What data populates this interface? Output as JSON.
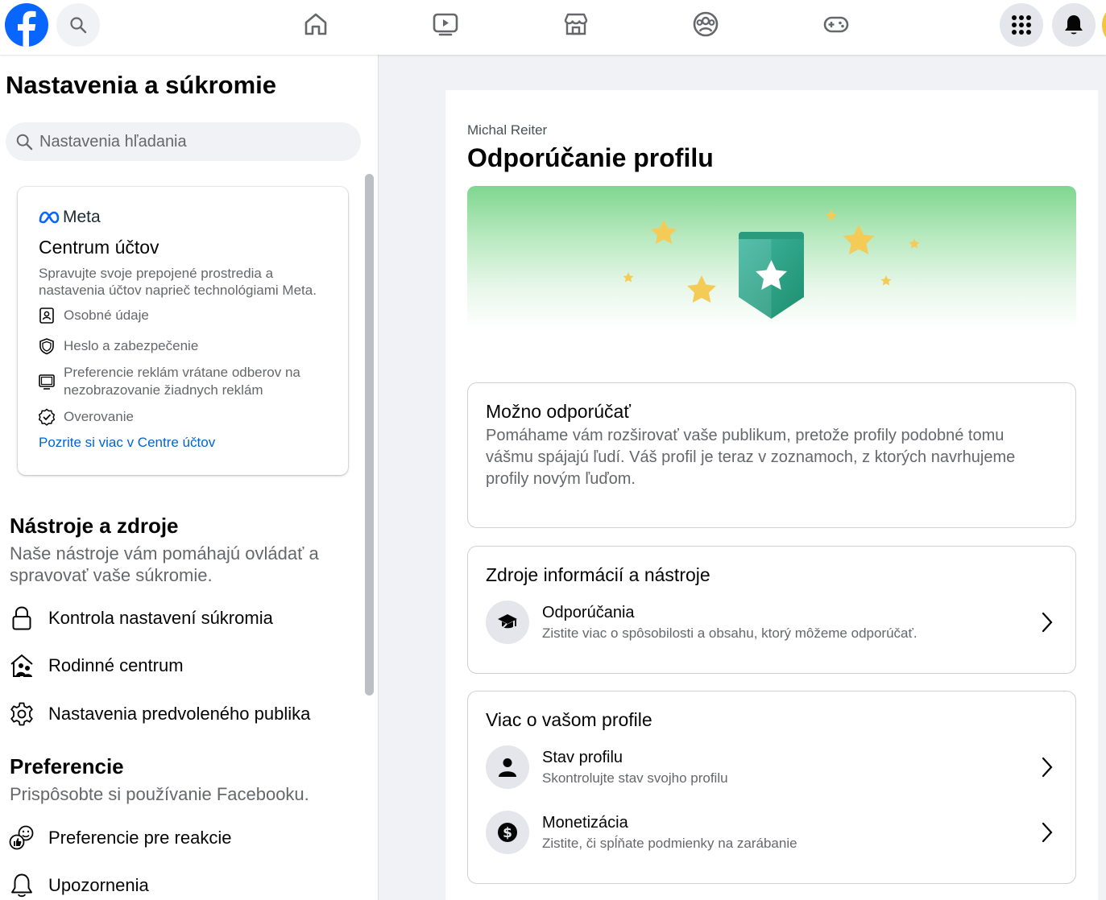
{
  "topbar": {
    "nav": [
      "home-icon",
      "watch-icon",
      "marketplace-icon",
      "groups-icon",
      "gaming-icon"
    ],
    "right": [
      "menu-icon",
      "notifications-icon"
    ]
  },
  "sidebar": {
    "title": "Nastavenia a súkromie",
    "search_placeholder": "Nastavenia hľadania",
    "meta_card": {
      "brand": "Meta",
      "title": "Centrum účtov",
      "description": "Spravujte svoje prepojené prostredia a nastavenia účtov naprieč technológiami Meta.",
      "items": [
        {
          "icon": "id-card-icon",
          "label": "Osobné údaje"
        },
        {
          "icon": "shield-icon",
          "label": "Heslo a zabezpečenie"
        },
        {
          "icon": "monitor-icon",
          "label": "Preferencie reklám vrátane odberov na nezobrazovanie žiadnych reklám"
        },
        {
          "icon": "verified-check-icon",
          "label": "Overovanie"
        }
      ],
      "link": "Pozrite si viac v Centre účtov"
    },
    "tools": {
      "title": "Nástroje a zdroje",
      "description": "Naše nástroje vám pomáhajú ovládať a spravovať vaše súkromie.",
      "items": [
        {
          "icon": "lock-icon",
          "label": "Kontrola nastavení súkromia"
        },
        {
          "icon": "family-home-icon",
          "label": "Rodinné centrum"
        },
        {
          "icon": "gear-icon",
          "label": "Nastavenia predvoleného publika"
        }
      ]
    },
    "preferences": {
      "title": "Preferencie",
      "description": "Prispôsobte si používanie Facebooku.",
      "items": [
        {
          "icon": "reactions-icon",
          "label": "Preferencie pre reakcie"
        },
        {
          "icon": "bell-icon",
          "label": "Upozornenia"
        }
      ]
    }
  },
  "main": {
    "owner": "Michal Reiter",
    "title": "Odporúčanie profilu",
    "status_card": {
      "title": "Možno odporúčať",
      "text": "Pomáhame vám rozširovať vaše publikum, pretože profily podobné tomu vášmu spájajú ľudí. Váš profil je teraz v zoznamoch, z ktorých navrhujeme profily novým ľuďom."
    },
    "resources_card": {
      "title": "Zdroje informácií a nástroje",
      "rows": [
        {
          "icon": "graduation-cap-icon",
          "title": "Odporúčania",
          "subtitle": "Zistite viac o spôsobilosti a obsahu, ktorý môžeme odporúčať."
        }
      ]
    },
    "profile_card": {
      "title": "Viac o vašom profile",
      "rows": [
        {
          "icon": "person-icon",
          "title": "Stav profilu",
          "subtitle": "Skontrolujte stav svojho profilu"
        },
        {
          "icon": "dollar-icon",
          "title": "Monetizácia",
          "subtitle": "Zistite, či spĺňate podmienky na zarábanie"
        }
      ]
    }
  }
}
